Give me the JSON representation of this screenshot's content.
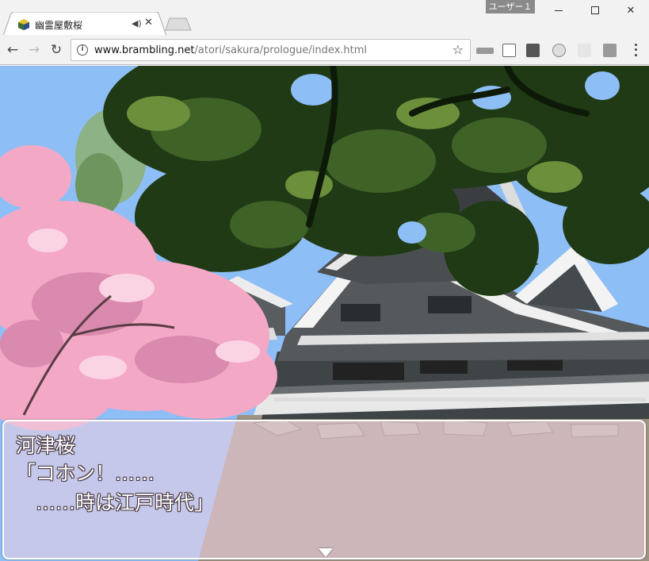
{
  "window": {
    "user_label": "ユーザー１"
  },
  "tab": {
    "title": "幽霊屋敷桜",
    "audio_icon": "speaker-icon",
    "close_glyph": "✕"
  },
  "toolbar": {
    "url_host": "www.brambling.net",
    "url_path": "/atori/sakura/prologue/index.html",
    "extensions": [
      "extension-icon",
      "pdf-extension-icon",
      "download-extension-icon",
      "globe-extension-icon",
      "extension-icon",
      "adobe-extension-icon"
    ]
  },
  "dialogue": {
    "speaker": "河津桜",
    "line1": "「コホン！……",
    "line2": "　……時は江戸時代」"
  },
  "colors": {
    "sky": "#8ebef6",
    "message_window": "#eecee2",
    "blossom": "#f3a9c6"
  }
}
